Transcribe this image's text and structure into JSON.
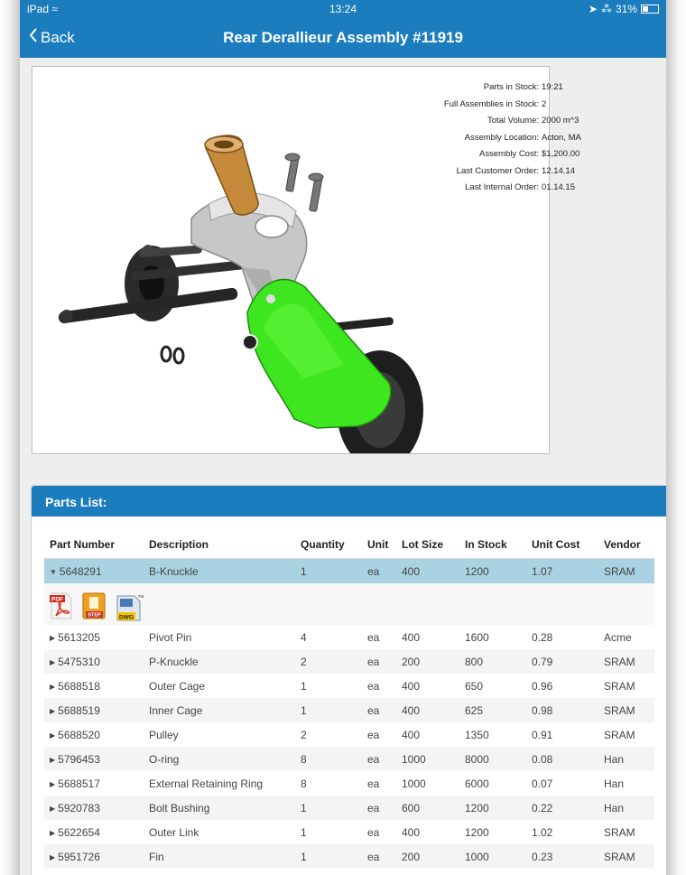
{
  "status_bar": {
    "device": "iPad",
    "time": "13:24",
    "battery": "31%"
  },
  "nav": {
    "back_label": "Back",
    "title": "Rear Derallieur Assembly #11919"
  },
  "stats": [
    {
      "label": "Parts in Stock:",
      "value": "19:21"
    },
    {
      "label": "Full Assemblies in Stock:",
      "value": "2"
    },
    {
      "label": "Total Volume:",
      "value": "2000 m^3"
    },
    {
      "label": "Assembly Location:",
      "value": "Acton, MA"
    },
    {
      "label": "Assembly Cost:",
      "value": "$1,200.00"
    },
    {
      "label": "Last Customer Order:",
      "value": "12.14.14"
    },
    {
      "label": "Last Internal Order:",
      "value": "01.14.15"
    }
  ],
  "parts": {
    "title": "Parts List:",
    "columns": [
      "Part Number",
      "Description",
      "Quantity",
      "Unit",
      "Lot Size",
      "In Stock",
      "Unit Cost",
      "Vendor"
    ],
    "file_icons": {
      "pdf": "PDF",
      "step": "STEP",
      "dwg": "DWG",
      "tm": "TM"
    },
    "rows": [
      {
        "part": "5648291",
        "desc": "B-Knuckle",
        "qty": "1",
        "unit": "ea",
        "lot": "400",
        "stock": "1200",
        "cost": "1.07",
        "vendor": "SRAM"
      },
      {
        "part": "5613205",
        "desc": "Pivot Pin",
        "qty": "4",
        "unit": "ea",
        "lot": "400",
        "stock": "1600",
        "cost": "0.28",
        "vendor": "Acme"
      },
      {
        "part": "5475310",
        "desc": "P-Knuckle",
        "qty": "2",
        "unit": "ea",
        "lot": "200",
        "stock": "800",
        "cost": "0.79",
        "vendor": "SRAM"
      },
      {
        "part": "5688518",
        "desc": "Outer Cage",
        "qty": "1",
        "unit": "ea",
        "lot": "400",
        "stock": "650",
        "cost": "0.96",
        "vendor": "SRAM"
      },
      {
        "part": "5688519",
        "desc": "Inner Cage",
        "qty": "1",
        "unit": "ea",
        "lot": "400",
        "stock": "625",
        "cost": "0.98",
        "vendor": "SRAM"
      },
      {
        "part": "5688520",
        "desc": "Pulley",
        "qty": "2",
        "unit": "ea",
        "lot": "400",
        "stock": "1350",
        "cost": "0.91",
        "vendor": "SRAM"
      },
      {
        "part": "5796453",
        "desc": "O-ring",
        "qty": "8",
        "unit": "ea",
        "lot": "1000",
        "stock": "8000",
        "cost": "0.08",
        "vendor": "Han"
      },
      {
        "part": "5688517",
        "desc": "External Retaining Ring",
        "qty": "8",
        "unit": "ea",
        "lot": "1000",
        "stock": "6000",
        "cost": "0.07",
        "vendor": "Han"
      },
      {
        "part": "5920783",
        "desc": "Bolt Bushing",
        "qty": "1",
        "unit": "ea",
        "lot": "600",
        "stock": "1200",
        "cost": "0.22",
        "vendor": "Han"
      },
      {
        "part": "5622654",
        "desc": "Outer Link",
        "qty": "1",
        "unit": "ea",
        "lot": "400",
        "stock": "1200",
        "cost": "1.02",
        "vendor": "SRAM"
      },
      {
        "part": "5951726",
        "desc": "Fin",
        "qty": "1",
        "unit": "ea",
        "lot": "200",
        "stock": "1000",
        "cost": "0.23",
        "vendor": "SRAM"
      }
    ]
  },
  "colors": {
    "bar_blue": "#1b7dbd",
    "selected_row": "#a9d3e3",
    "highlight_green": "#3ee61f"
  }
}
